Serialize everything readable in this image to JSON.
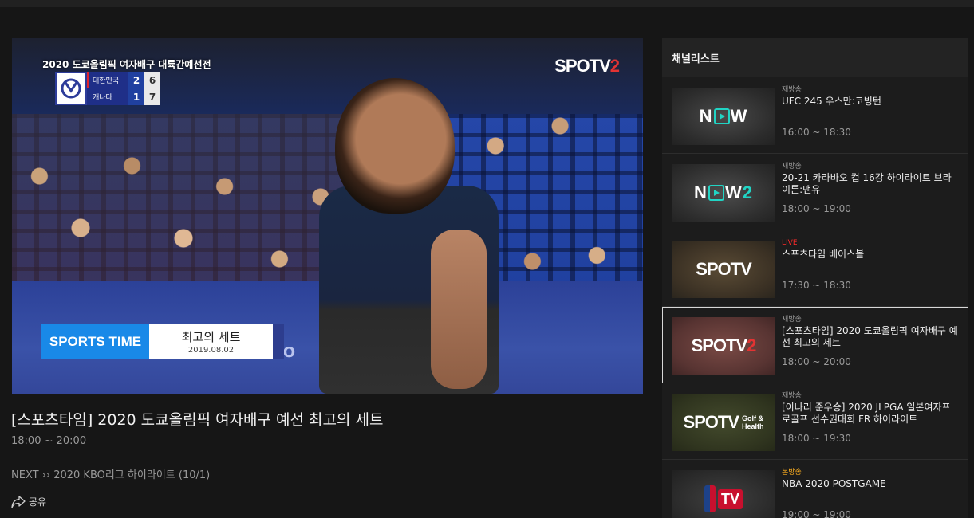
{
  "player": {
    "broadcast_title": "2020 도쿄올림픽 여자배구 대륙간예선전",
    "scoreboard": {
      "teams": [
        {
          "name": "대한민국",
          "sets": "2",
          "points": "6"
        },
        {
          "name": "캐나다",
          "sets": "1",
          "points": "7"
        }
      ]
    },
    "channel_logo": {
      "main": "SPOTV",
      "num": "2"
    },
    "lower_third": {
      "brand": "SPORTS TIME",
      "title": "최고의 세트",
      "date": "2019.08.02"
    },
    "ad_text": "O V O"
  },
  "program": {
    "title": "[스포츠타임] 2020 도쿄올림픽 여자배구 예선 최고의 세트",
    "time": "18:00 ~ 20:00",
    "next": "NEXT ›› 2020 KBO리그 하이라이트 (10/1)",
    "share_label": "공유"
  },
  "channel_list": {
    "header": "채널리스트",
    "items": [
      {
        "logo": "NOW",
        "tag": "재방송",
        "tag_type": "re",
        "title": "UFC 245 우스만:코빙턴",
        "time": "16:00 ~ 18:30"
      },
      {
        "logo": "NOW2",
        "tag": "재방송",
        "tag_type": "re",
        "title": "20-21 카라바오 컵 16강 하이라이트 브라이튼:맨유",
        "time": "18:00 ~ 19:00"
      },
      {
        "logo": "SPOTV",
        "tag": "LIVE",
        "tag_type": "live",
        "title": "스포츠타임 베이스볼",
        "time": "17:30 ~ 18:30"
      },
      {
        "logo": "SPOTV2",
        "tag": "재방송",
        "tag_type": "re",
        "title": "[스포츠타임] 2020 도쿄올림픽 여자배구 예선 최고의 세트",
        "time": "18:00 ~ 20:00",
        "active": true
      },
      {
        "logo": "SPOTV Golf & Health",
        "tag": "재방송",
        "tag_type": "re",
        "title": "[이나리 준우승] 2020 JLPGA 일본여자프로골프 선수권대회 FR 하이라이트",
        "time": "18:00 ~ 19:30"
      },
      {
        "logo": "NBA TV",
        "tag": "본방송",
        "tag_type": "main",
        "title": "NBA 2020 POSTGAME",
        "time": "19:00 ~ 19:00"
      }
    ]
  },
  "colors": {
    "live": "#ff2a2a",
    "main_broadcast": "#ffb01f",
    "accent": "#21d4c4",
    "spotv_red": "#e33333"
  }
}
